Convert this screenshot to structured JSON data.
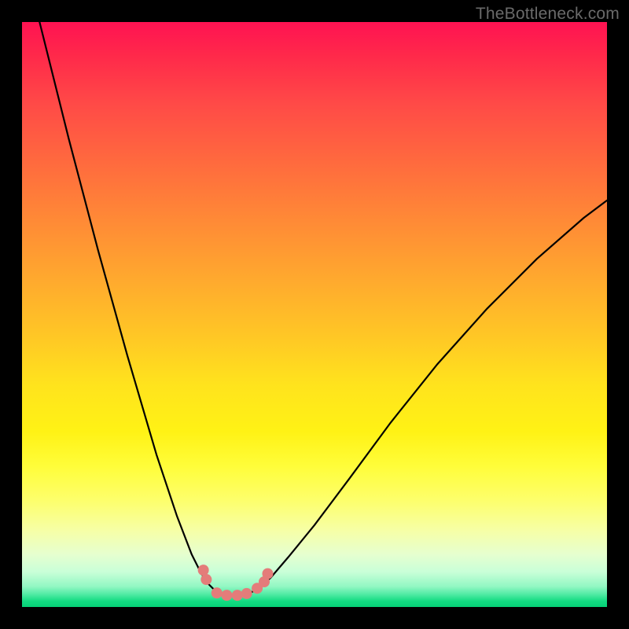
{
  "watermark": "TheBottleneck.com",
  "chart_data": {
    "type": "line",
    "title": "",
    "xlabel": "",
    "ylabel": "",
    "xlim": [
      0,
      100
    ],
    "ylim": [
      0,
      100
    ],
    "axes_visible": false,
    "grid": false,
    "background": "rainbow-gradient-red-top-green-bottom",
    "series": [
      {
        "name": "left-branch",
        "x": [
          3.0,
          8.0,
          13.0,
          18.0,
          23.0,
          26.5,
          29.0,
          30.5,
          31.6,
          32.6,
          33.6
        ],
        "y": [
          100.0,
          80.0,
          61.0,
          43.0,
          26.0,
          15.5,
          9.0,
          6.0,
          4.2,
          3.2,
          2.4
        ]
      },
      {
        "name": "valley-floor",
        "x": [
          33.6,
          35.0,
          36.4,
          37.8,
          39.0
        ],
        "y": [
          2.4,
          2.1,
          2.0,
          2.1,
          2.4
        ]
      },
      {
        "name": "right-branch",
        "x": [
          39.0,
          40.5,
          42.5,
          45.5,
          50.0,
          56.0,
          63.0,
          71.0,
          79.5,
          88.0,
          96.0,
          100.0
        ],
        "y": [
          2.4,
          3.2,
          5.0,
          8.5,
          14.0,
          22.0,
          31.5,
          41.5,
          51.0,
          59.5,
          66.5,
          69.5
        ]
      }
    ],
    "markers": [
      {
        "x": 31.0,
        "y": 6.3
      },
      {
        "x": 31.5,
        "y": 4.7
      },
      {
        "x": 33.3,
        "y": 2.4
      },
      {
        "x": 35.0,
        "y": 2.0
      },
      {
        "x": 36.8,
        "y": 2.0
      },
      {
        "x": 38.4,
        "y": 2.3
      },
      {
        "x": 40.2,
        "y": 3.2
      },
      {
        "x": 41.4,
        "y": 4.3
      },
      {
        "x": 42.0,
        "y": 5.7
      }
    ],
    "marker_style": {
      "color": "#e47c7a",
      "radius_px": 7
    }
  }
}
